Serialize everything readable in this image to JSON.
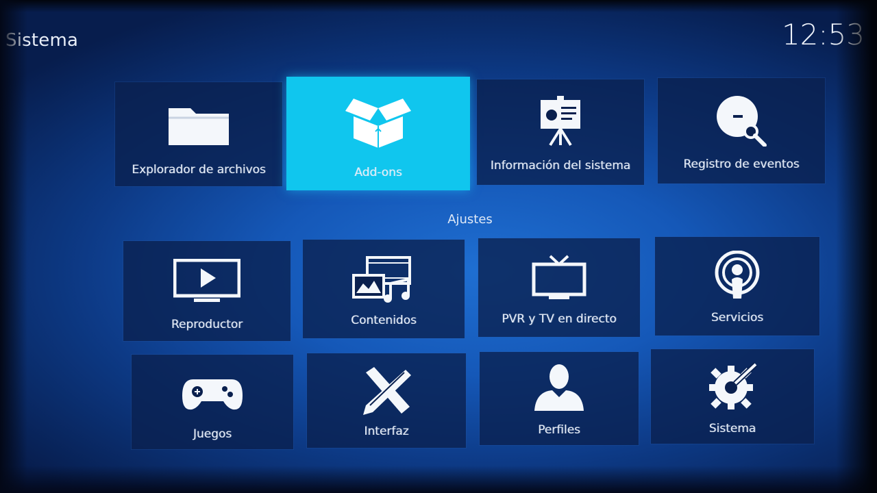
{
  "header": {
    "title": "Sistema",
    "clock": "12:53"
  },
  "top_row": [
    {
      "label": "Explorador de archivos",
      "icon": "folder-icon"
    },
    {
      "label": "Add-ons",
      "icon": "open-box-icon",
      "active": true
    },
    {
      "label": "Información del sistema",
      "icon": "presentation-board-icon"
    },
    {
      "label": "Registro de eventos",
      "icon": "clock-search-icon"
    }
  ],
  "section_title": "Ajustes",
  "settings": [
    {
      "label": "Reproductor",
      "icon": "play-monitor-icon"
    },
    {
      "label": "Contenidos",
      "icon": "media-library-icon"
    },
    {
      "label": "PVR y TV en directo",
      "icon": "tv-antenna-icon"
    },
    {
      "label": "Servicios",
      "icon": "podcast-icon"
    },
    {
      "label": "Juegos",
      "icon": "gamepad-icon"
    },
    {
      "label": "Interfaz",
      "icon": "pencil-ruler-icon"
    },
    {
      "label": "Perfiles",
      "icon": "user-icon"
    },
    {
      "label": "Sistema",
      "icon": "gear-wrench-icon"
    }
  ],
  "colors": {
    "background": "#1558b8",
    "tile": "#0a204e",
    "active_tile": "#10c6ee",
    "text": "#e4ecf8"
  }
}
